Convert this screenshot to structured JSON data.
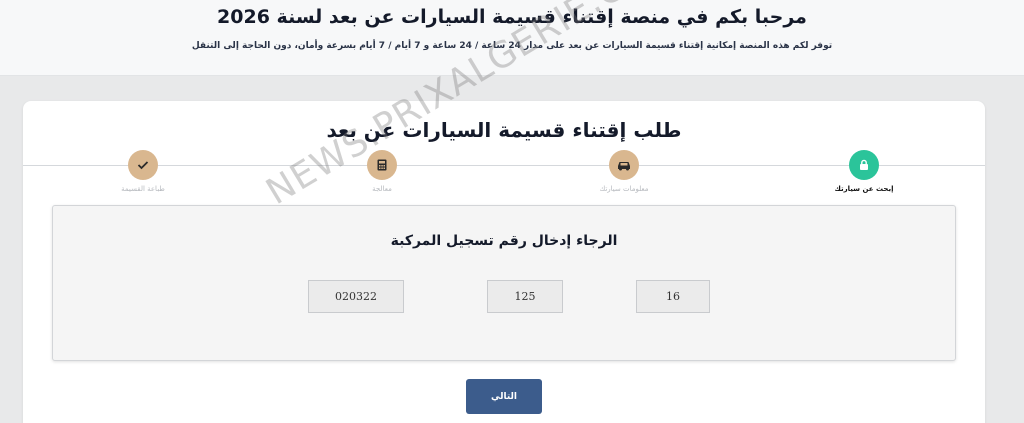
{
  "banner": {
    "title": "مرحبا بكم في منصة إقتناء قسيمة السيارات عن بعد لسنة 2026",
    "subtitle": "توفر لكم هذه المنصة إمكانية إقتناء قسيمة السيارات عن بعد على مدار 24 ساعة / 24 ساعة و 7 أيام / 7 أيام بسرعة وأمان، دون الحاجة إلى التنقل"
  },
  "card": {
    "title": "طلب إقتناء قسيمة السيارات عن بعد"
  },
  "steps": [
    {
      "label": "إبحث عن سيارتك",
      "icon": "lock-icon",
      "state": "active"
    },
    {
      "label": "معلومات سيارتك",
      "icon": "car-icon",
      "state": "done"
    },
    {
      "label": "معالجة",
      "icon": "calculator-icon",
      "state": "done"
    },
    {
      "label": "طباعة القسيمة",
      "icon": "check-icon",
      "state": "done"
    }
  ],
  "form": {
    "heading": "الرجاء إدخال رقم تسجيل المركبة",
    "field1_value": "16",
    "field2_value": "125",
    "field3_value": "020322"
  },
  "next_label": "التالي",
  "watermark": "NEWS.PRIXALGERIE.COM",
  "colors": {
    "active_step": "#2bc49a",
    "done_step": "#d9b78f",
    "primary_button": "#3c5c8c"
  }
}
